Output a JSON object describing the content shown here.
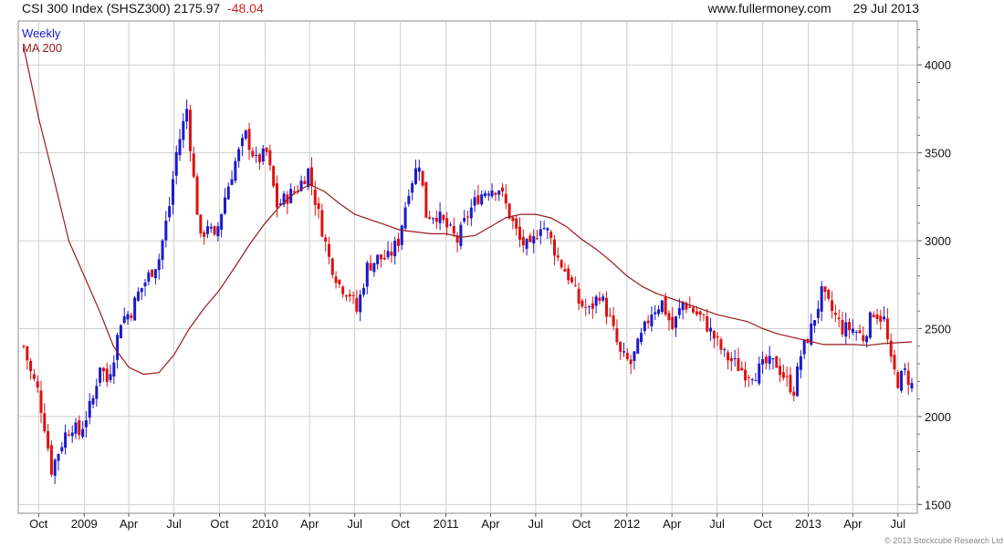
{
  "header": {
    "title": "CSI 300 Index (SHSZ300)",
    "price": "2175.97",
    "change": "-48.04",
    "site": "www.fullermoney.com",
    "date": "29 Jul 2013"
  },
  "footer": {
    "copyright": "© 2013 Stockcube Research Ltd"
  },
  "colors": {
    "up": "#1a1acc",
    "down": "#dd1111",
    "ma": "#991a1a",
    "grid": "#cfcfcf"
  },
  "chart_data": {
    "type": "candlestick",
    "title": "CSI 300 Index (SHSZ300)",
    "legend": [
      {
        "label": "Weekly",
        "color": "#1a1acc"
      },
      {
        "label": "MA 200",
        "color": "#991a1a"
      }
    ],
    "x_ticks": [
      "Oct",
      "2009",
      "Apr",
      "Jul",
      "Oct",
      "2010",
      "Apr",
      "Jul",
      "Oct",
      "2011",
      "Apr",
      "Jul",
      "Oct",
      "2012",
      "Apr",
      "Jul",
      "Oct",
      "2013",
      "Apr",
      "Jul"
    ],
    "y_ticks": [
      1500,
      2000,
      2500,
      3000,
      3500,
      4000
    ],
    "ylim": [
      1450,
      4250
    ],
    "x_range": [
      "2008-09-01",
      "2013-07-29"
    ],
    "close_weekly_approx": [
      [
        "2008-09-01",
        2400
      ],
      [
        "2008-09-15",
        2250
      ],
      [
        "2008-09-29",
        2150
      ],
      [
        "2008-10-13",
        1950
      ],
      [
        "2008-10-27",
        1700
      ],
      [
        "2008-11-10",
        1800
      ],
      [
        "2008-11-24",
        1900
      ],
      [
        "2008-12-08",
        1950
      ],
      [
        "2008-12-22",
        1900
      ],
      [
        "2009-01-05",
        2000
      ],
      [
        "2009-01-19",
        2100
      ],
      [
        "2009-02-02",
        2300
      ],
      [
        "2009-02-16",
        2200
      ],
      [
        "2009-03-02",
        2350
      ],
      [
        "2009-03-16",
        2550
      ],
      [
        "2009-04-06",
        2600
      ],
      [
        "2009-04-20",
        2700
      ],
      [
        "2009-05-11",
        2800
      ],
      [
        "2009-06-01",
        2900
      ],
      [
        "2009-06-22",
        3200
      ],
      [
        "2009-07-06",
        3500
      ],
      [
        "2009-07-27",
        3750
      ],
      [
        "2009-08-10",
        3350
      ],
      [
        "2009-08-24",
        3000
      ],
      [
        "2009-09-07",
        3100
      ],
      [
        "2009-09-21",
        3000
      ],
      [
        "2009-10-12",
        3250
      ],
      [
        "2009-11-02",
        3450
      ],
      [
        "2009-11-23",
        3600
      ],
      [
        "2009-12-14",
        3450
      ],
      [
        "2010-01-04",
        3500
      ],
      [
        "2010-01-25",
        3200
      ],
      [
        "2010-02-15",
        3250
      ],
      [
        "2010-03-08",
        3300
      ],
      [
        "2010-03-29",
        3400
      ],
      [
        "2010-04-19",
        3150
      ],
      [
        "2010-05-10",
        2900
      ],
      [
        "2010-05-31",
        2750
      ],
      [
        "2010-06-21",
        2700
      ],
      [
        "2010-07-05",
        2600
      ],
      [
        "2010-07-26",
        2850
      ],
      [
        "2010-08-16",
        2900
      ],
      [
        "2010-09-06",
        2900
      ],
      [
        "2010-09-27",
        3000
      ],
      [
        "2010-10-18",
        3300
      ],
      [
        "2010-11-08",
        3450
      ],
      [
        "2010-11-22",
        3150
      ],
      [
        "2010-12-13",
        3150
      ],
      [
        "2011-01-10",
        3050
      ],
      [
        "2011-01-24",
        3000
      ],
      [
        "2011-02-14",
        3150
      ],
      [
        "2011-03-07",
        3250
      ],
      [
        "2011-03-28",
        3300
      ],
      [
        "2011-04-18",
        3300
      ],
      [
        "2011-05-09",
        3150
      ],
      [
        "2011-05-30",
        3000
      ],
      [
        "2011-06-20",
        2950
      ],
      [
        "2011-07-11",
        3100
      ],
      [
        "2011-07-25",
        3050
      ],
      [
        "2011-08-15",
        2900
      ],
      [
        "2011-09-05",
        2800
      ],
      [
        "2011-09-26",
        2650
      ],
      [
        "2011-10-17",
        2600
      ],
      [
        "2011-11-07",
        2700
      ],
      [
        "2011-11-28",
        2550
      ],
      [
        "2011-12-19",
        2350
      ],
      [
        "2012-01-09",
        2300
      ],
      [
        "2012-01-30",
        2450
      ],
      [
        "2012-02-20",
        2600
      ],
      [
        "2012-03-12",
        2650
      ],
      [
        "2012-04-02",
        2500
      ],
      [
        "2012-04-23",
        2650
      ],
      [
        "2012-05-14",
        2600
      ],
      [
        "2012-06-04",
        2550
      ],
      [
        "2012-06-25",
        2450
      ],
      [
        "2012-07-16",
        2350
      ],
      [
        "2012-08-06",
        2300
      ],
      [
        "2012-08-27",
        2250
      ],
      [
        "2012-09-17",
        2250
      ],
      [
        "2012-10-08",
        2300
      ],
      [
        "2012-10-29",
        2300
      ],
      [
        "2012-11-19",
        2200
      ],
      [
        "2012-12-03",
        2150
      ],
      [
        "2012-12-17",
        2350
      ],
      [
        "2013-01-07",
        2500
      ],
      [
        "2013-01-28",
        2700
      ],
      [
        "2013-02-18",
        2600
      ],
      [
        "2013-03-11",
        2500
      ],
      [
        "2013-04-01",
        2500
      ],
      [
        "2013-04-22",
        2450
      ],
      [
        "2013-05-13",
        2600
      ],
      [
        "2013-06-03",
        2550
      ],
      [
        "2013-06-17",
        2300
      ],
      [
        "2013-07-01",
        2200
      ],
      [
        "2013-07-15",
        2250
      ],
      [
        "2013-07-29",
        2176
      ]
    ],
    "ma200_approx": [
      [
        "2008-09-01",
        4100
      ],
      [
        "2008-10-01",
        3700
      ],
      [
        "2008-11-01",
        3350
      ],
      [
        "2008-12-01",
        3000
      ],
      [
        "2009-01-01",
        2800
      ],
      [
        "2009-02-01",
        2600
      ],
      [
        "2009-03-01",
        2400
      ],
      [
        "2009-04-01",
        2280
      ],
      [
        "2009-05-01",
        2240
      ],
      [
        "2009-06-01",
        2250
      ],
      [
        "2009-07-01",
        2350
      ],
      [
        "2009-08-01",
        2500
      ],
      [
        "2009-09-01",
        2620
      ],
      [
        "2009-10-01",
        2720
      ],
      [
        "2009-11-01",
        2850
      ],
      [
        "2009-12-01",
        2980
      ],
      [
        "2010-01-01",
        3100
      ],
      [
        "2010-02-01",
        3200
      ],
      [
        "2010-03-01",
        3270
      ],
      [
        "2010-04-01",
        3320
      ],
      [
        "2010-05-01",
        3280
      ],
      [
        "2010-06-01",
        3210
      ],
      [
        "2010-07-01",
        3150
      ],
      [
        "2010-08-01",
        3120
      ],
      [
        "2010-09-01",
        3090
      ],
      [
        "2010-10-01",
        3060
      ],
      [
        "2010-11-01",
        3050
      ],
      [
        "2010-12-01",
        3040
      ],
      [
        "2011-01-01",
        3040
      ],
      [
        "2011-02-01",
        3020
      ],
      [
        "2011-03-01",
        3030
      ],
      [
        "2011-04-01",
        3080
      ],
      [
        "2011-05-01",
        3130
      ],
      [
        "2011-06-01",
        3150
      ],
      [
        "2011-07-01",
        3150
      ],
      [
        "2011-08-01",
        3130
      ],
      [
        "2011-09-01",
        3080
      ],
      [
        "2011-10-01",
        3010
      ],
      [
        "2011-11-01",
        2950
      ],
      [
        "2011-12-01",
        2880
      ],
      [
        "2012-01-01",
        2800
      ],
      [
        "2012-02-01",
        2740
      ],
      [
        "2012-03-01",
        2700
      ],
      [
        "2012-04-01",
        2670
      ],
      [
        "2012-05-01",
        2640
      ],
      [
        "2012-06-01",
        2610
      ],
      [
        "2012-07-01",
        2580
      ],
      [
        "2012-08-01",
        2560
      ],
      [
        "2012-09-01",
        2540
      ],
      [
        "2012-10-01",
        2500
      ],
      [
        "2012-11-01",
        2470
      ],
      [
        "2012-12-01",
        2450
      ],
      [
        "2013-01-01",
        2430
      ],
      [
        "2013-02-01",
        2410
      ],
      [
        "2013-03-01",
        2410
      ],
      [
        "2013-04-01",
        2410
      ],
      [
        "2013-05-01",
        2405
      ],
      [
        "2013-06-01",
        2415
      ],
      [
        "2013-07-29",
        2425
      ]
    ],
    "grid": true
  }
}
